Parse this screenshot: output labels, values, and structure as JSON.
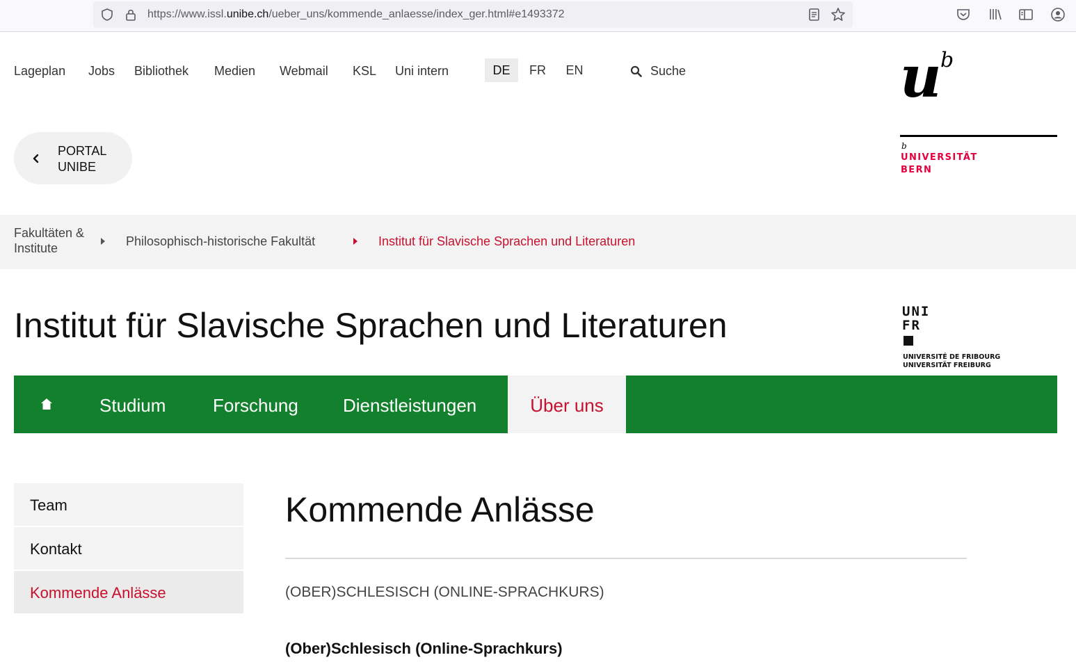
{
  "browser": {
    "url_prefix": "https://www.issl.",
    "url_domain": "unibe.ch",
    "url_suffix": "/ueber_uns/kommende_anlaesse/index_ger.html#e1493372"
  },
  "service_nav": {
    "links": [
      "Lageplan",
      "Jobs",
      "Bibliothek",
      "Medien",
      "Webmail",
      "KSL",
      "Uni intern"
    ],
    "languages": [
      "DE",
      "FR",
      "EN"
    ],
    "active_language": "DE",
    "search_label": "Suche"
  },
  "portal": {
    "line1": "PORTAL",
    "line2": "UNIBE"
  },
  "unibe_logo": {
    "mark_u": "u",
    "mark_b": "b",
    "small_b": "b",
    "line1": "UNIVERSITÄT",
    "line2": "BERN",
    "accent": "#e3003f"
  },
  "breadcrumb": {
    "items": [
      "Fakultäten & Institute",
      "Philosophisch-historische Fakultät",
      "Institut für Slavische Sprachen und Literaturen"
    ]
  },
  "institute_title": "Institut für Slavische Sprachen und Literaturen",
  "unifr_logo": {
    "word1": "UNI",
    "word2": "FR",
    "caption1": "UNIVERSITÉ DE FRIBOURG",
    "caption2": "UNIVERSITÄT FREIBURG"
  },
  "main_nav": {
    "home_icon": "home-icon",
    "items": [
      "Studium",
      "Forschung",
      "Dienstleistungen",
      "Über uns"
    ],
    "active": "Über uns",
    "color": "#12802c"
  },
  "sub_nav": {
    "items": [
      "Team",
      "Kontakt",
      "Kommende Anlässe"
    ],
    "active": "Kommende Anlässe"
  },
  "content": {
    "page_title": "Kommende Anlässe",
    "event_category": "(OBER)SCHLESISCH (ONLINE-SPRACHKURS)",
    "event_title": "(Ober)Schlesisch (Online-Sprachkurs)"
  },
  "colors": {
    "accent_red": "#c8102e",
    "green": "#12802c"
  }
}
